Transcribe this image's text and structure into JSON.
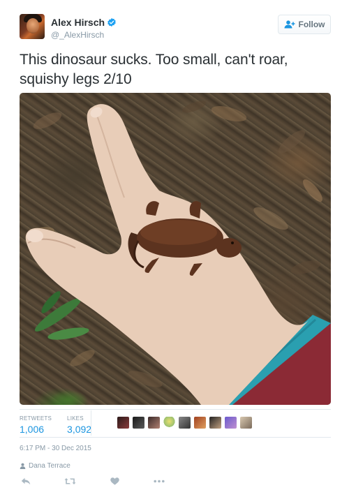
{
  "user": {
    "display_name": "Alex Hirsch",
    "handle": "@_AlexHirsch",
    "verified": true,
    "avatar_icon": "profile-photo"
  },
  "follow": {
    "label": "Follow",
    "icon": "follow-icon"
  },
  "tweet": {
    "text": "This dinosaur sucks. Too small, can't roar, squishy legs 2/10",
    "media": "photo of a newt on a hand over leaf litter"
  },
  "stats": {
    "retweets_label": "RETWEETS",
    "retweets_value": "1,006",
    "likes_label": "LIKES",
    "likes_value": "3,092"
  },
  "likers": [
    "liker-avatar-1",
    "liker-avatar-2",
    "liker-avatar-3",
    "liker-avatar-4",
    "liker-avatar-5",
    "liker-avatar-6",
    "liker-avatar-7",
    "liker-avatar-8",
    "liker-avatar-9"
  ],
  "timestamp": "6:17 PM - 30 Dec 2015",
  "retweeted_by": "Dana Terrace",
  "actions": [
    "reply-icon",
    "retweet-icon",
    "like-icon",
    "more-icon"
  ],
  "colors": {
    "accent": "#1b95e0",
    "muted": "#8899a6",
    "text": "#292f33",
    "border": "#e1e8ed"
  }
}
